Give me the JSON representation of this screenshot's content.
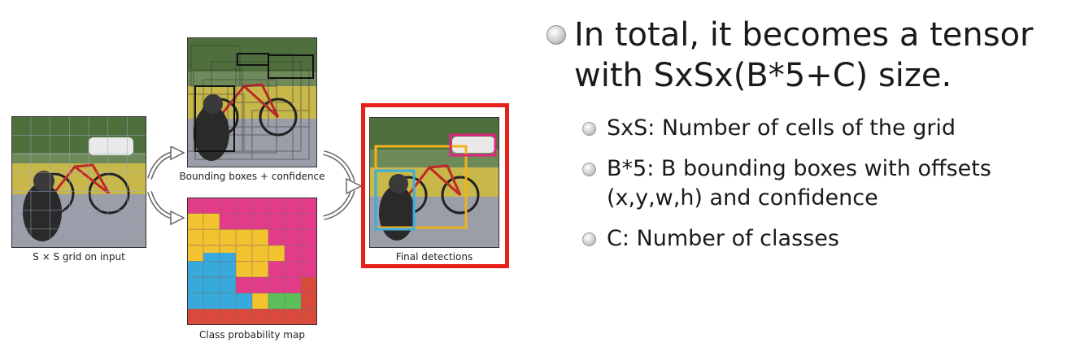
{
  "diagram": {
    "input_caption": "S × S grid on input",
    "bbox_caption": "Bounding boxes + confidence",
    "class_caption": "Class probability map",
    "final_caption": "Final detections",
    "colors": {
      "highlight_border": "#e8201a",
      "box_yellow": "#f2b21c",
      "box_blue": "#3aaee0",
      "box_magenta": "#e0257f",
      "class_magenta": "#e23b8a",
      "class_yellow": "#f2c230",
      "class_blue": "#38a9dc",
      "class_green": "#5cbf5a",
      "class_red": "#d94a3c"
    }
  },
  "text": {
    "main_bullet_line1": "In total, it becomes a tensor",
    "main_bullet_line2": "with SxSx(B*5+C) size.",
    "sub_bullets": [
      {
        "line1": "SxS: Number of cells of the grid"
      },
      {
        "line1": "B*5: B bounding boxes with offsets",
        "line2": "(x,y,w,h) and confidence"
      },
      {
        "line1": "C: Number of classes"
      }
    ]
  }
}
